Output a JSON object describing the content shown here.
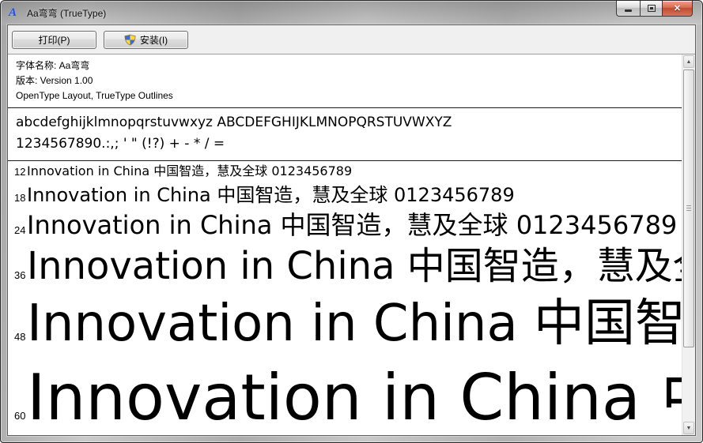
{
  "window": {
    "title": "Aa弯弯 (TrueType)"
  },
  "toolbar": {
    "print_label": "打印(P)",
    "install_label": "安装(I)"
  },
  "font_info": {
    "name": "字体名称: Aa弯弯",
    "version": "版本: Version 1.00",
    "outline": "OpenType Layout, TrueType Outlines"
  },
  "glyph_samples": {
    "lowercase_uppercase": "abcdefghijklmnopqrstuvwxyz ABCDEFGHIJKLMNOPQRSTUVWXYZ",
    "numerals_punct": "1234567890.:,; ' \" (!?) + - * / ="
  },
  "preview": {
    "sample_text": "Innovation in China 中国智造，慧及全球 0123456789",
    "sizes": [
      "12",
      "18",
      "24",
      "36",
      "48",
      "60"
    ]
  },
  "icons": {
    "app": "A",
    "close": "✕",
    "scroll_up": "▲",
    "scroll_down": "▼"
  },
  "colors": {
    "close_button_red": "#c04a33",
    "shield_blue": "#3a6bd6",
    "shield_yellow": "#fcd83c",
    "titlebar_gray": "#b8b8b8",
    "toolbar_bg": "#f0f0f0",
    "text": "#000000"
  }
}
